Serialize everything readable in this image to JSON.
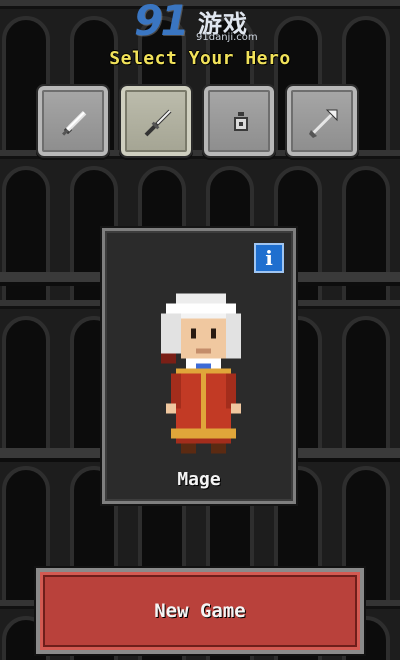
{
  "watermark": {
    "number": "91",
    "brand_cn": "游戏",
    "domain": "91danji.com"
  },
  "screen": {
    "title": "Select Your Hero"
  },
  "classes": [
    {
      "icon": "sword-icon",
      "selected": false
    },
    {
      "icon": "dagger-icon",
      "selected": true
    },
    {
      "icon": "amulet-icon",
      "selected": false
    },
    {
      "icon": "arrow-icon",
      "selected": false
    }
  ],
  "hero": {
    "name": "Mage",
    "info_label": "i"
  },
  "new_game": {
    "label": "New Game"
  },
  "colors": {
    "title": "#f1e25a",
    "button_red": "#b9413b",
    "info_blue": "#1f6fcf"
  }
}
